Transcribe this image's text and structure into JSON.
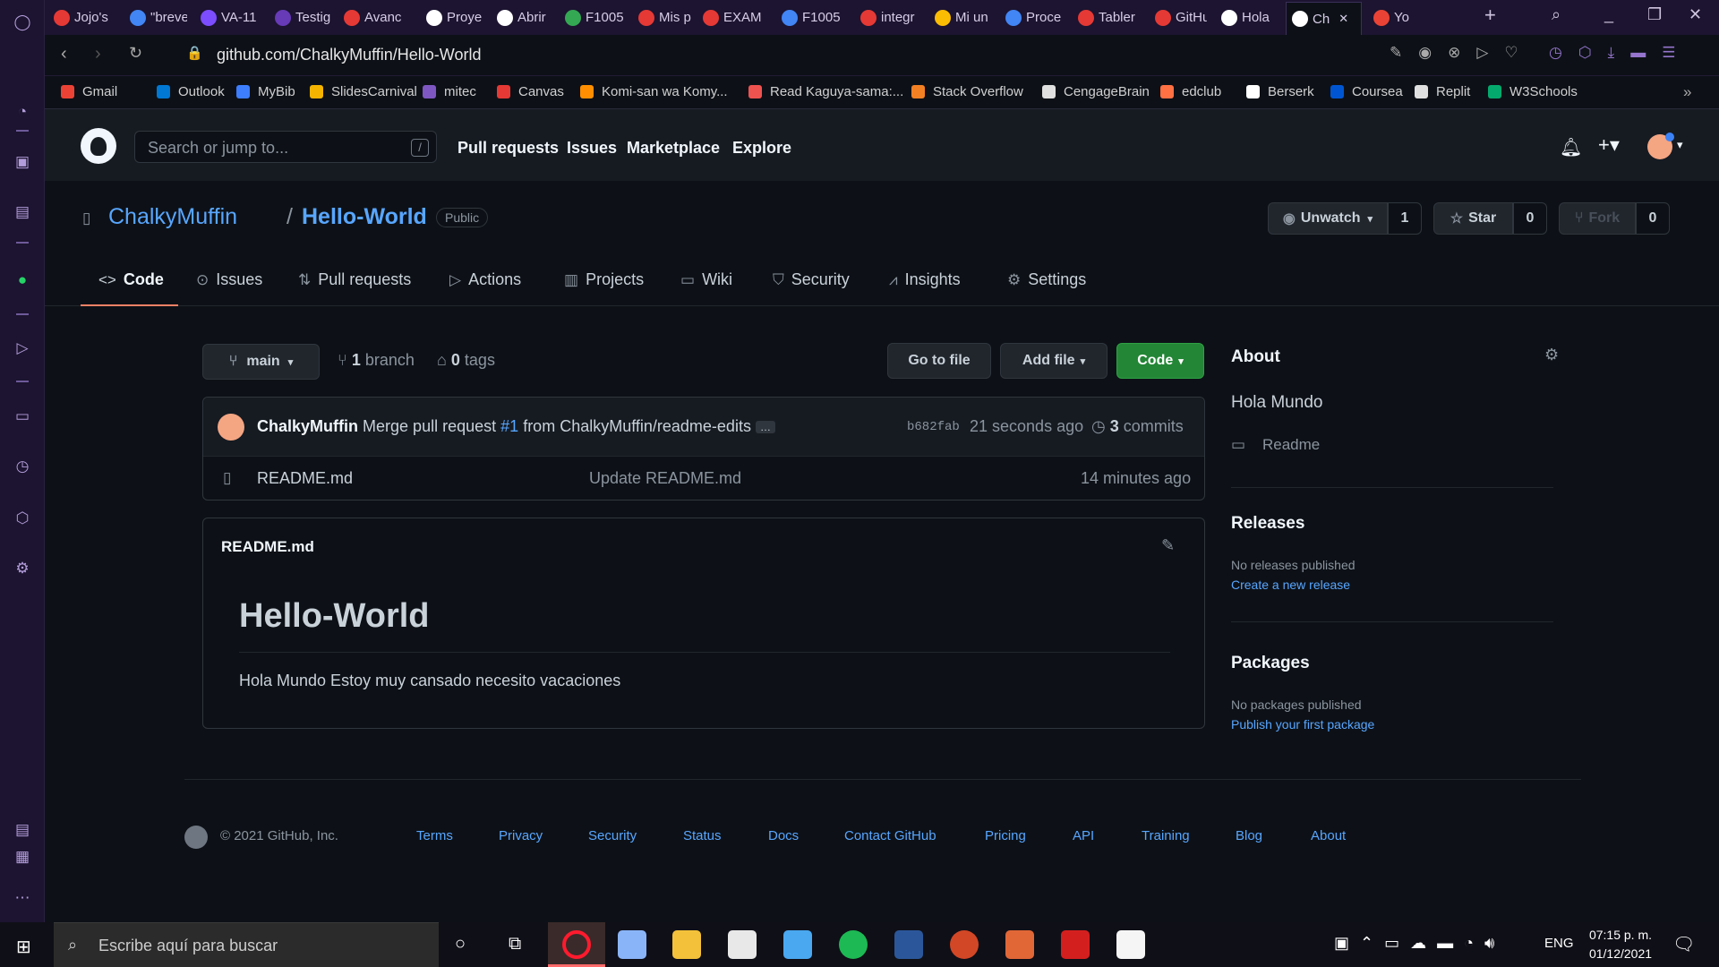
{
  "browser": {
    "tabs": [
      "Jojo's",
      "\"breve",
      "VA-11",
      "Testig",
      "Avanc",
      "Proye",
      "Abrir",
      "F1005",
      "Mis p",
      "EXAM",
      "F1005",
      "integr",
      "Mi un",
      "Proce",
      "Tabler",
      "GitHu",
      "Hola",
      "Ch",
      "Yo"
    ],
    "tab_colors": [
      "#e53935",
      "#4285f4",
      "#7c4dff",
      "#673ab7",
      "#e53935",
      "#ffffff",
      "#ffffff",
      "#34a853",
      "#e53935",
      "#e53935",
      "#4285f4",
      "#e53935",
      "#fbbc04",
      "#4285f4",
      "#e53935",
      "#e53935",
      "#ffffff",
      "#ffffff",
      "#ea4335"
    ],
    "url": "github.com/ChalkyMuffin/Hello-World",
    "bookmarks": [
      {
        "label": "Gmail",
        "color": "#ea4335"
      },
      {
        "label": "Outlook",
        "color": "#0078d4"
      },
      {
        "label": "MyBib",
        "color": "#3d7eff"
      },
      {
        "label": "SlidesCarnival",
        "color": "#f4b400"
      },
      {
        "label": "mitec",
        "color": "#7e57c2"
      },
      {
        "label": "Canvas",
        "color": "#e53935"
      },
      {
        "label": "Komi-san wa Komy...",
        "color": "#ff8f00"
      },
      {
        "label": "Read Kaguya-sama:...",
        "color": "#ef5350"
      },
      {
        "label": "Stack Overflow",
        "color": "#f48024"
      },
      {
        "label": "CengageBrain",
        "color": "#e0e0e0"
      },
      {
        "label": "edclub",
        "color": "#ff7043"
      },
      {
        "label": "Berserk",
        "color": "#ffffff"
      },
      {
        "label": "Coursea",
        "color": "#0056d2"
      },
      {
        "label": "Replit",
        "color": "#e0e0e0"
      },
      {
        "label": "W3Schools",
        "color": "#04aa6d"
      }
    ]
  },
  "github": {
    "search_placeholder": "Search or jump to...",
    "slash": "/",
    "nav": [
      "Pull requests",
      "Issues",
      "Marketplace",
      "Explore"
    ],
    "owner": "ChalkyMuffin",
    "sep": "/",
    "repo": "Hello-World",
    "visibility": "Public",
    "unwatch_label": "Unwatch",
    "unwatch_count": "1",
    "star_label": "Star",
    "star_count": "0",
    "fork_label": "Fork",
    "fork_count": "0",
    "repo_tabs": [
      "Code",
      "Issues",
      "Pull requests",
      "Actions",
      "Projects",
      "Wiki",
      "Security",
      "Insights",
      "Settings"
    ],
    "branch": "main",
    "branch_count": "1",
    "branch_label": "branch",
    "tag_count": "0",
    "tag_label": "tags",
    "goto_file": "Go to file",
    "add_file": "Add file",
    "code_btn": "Code",
    "commit_author": "ChalkyMuffin",
    "commit_msg_a": "Merge pull request",
    "commit_pr": "#1",
    "commit_msg_b": "from ChalkyMuffin/readme-edits",
    "commit_ellipsis": "…",
    "commit_sha": "b682fab",
    "commit_time": "21 seconds ago",
    "commits_count": "3",
    "commits_label": "commits",
    "file_name": "README.md",
    "file_msg": "Update README.md",
    "file_time": "14 minutes ago",
    "readme_title": "README.md",
    "readme_h1": "Hello-World",
    "readme_body": "Hola Mundo Estoy muy cansado necesito vacaciones",
    "about_title": "About",
    "about_desc": "Hola Mundo",
    "about_readme": "Readme",
    "releases_title": "Releases",
    "releases_none": "No releases published",
    "releases_link": "Create a new release",
    "packages_title": "Packages",
    "packages_none": "No packages published",
    "packages_link": "Publish your first package",
    "footer_copy": "© 2021 GitHub, Inc.",
    "footer_links": [
      "Terms",
      "Privacy",
      "Security",
      "Status",
      "Docs",
      "Contact GitHub",
      "Pricing",
      "API",
      "Training",
      "Blog",
      "About"
    ]
  },
  "taskbar": {
    "search": "Escribe aquí para buscar",
    "lang": "ENG",
    "time": "07:15 p. m.",
    "date": "01/12/2021"
  }
}
